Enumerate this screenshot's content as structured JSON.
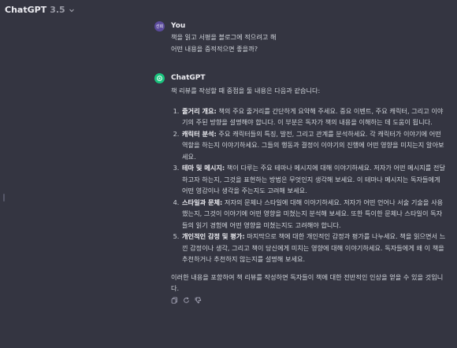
{
  "header": {
    "model_name": "ChatGPT",
    "model_version": "3.5",
    "dropdown_icon": "chevron-down-icon"
  },
  "conversation": {
    "user_message": {
      "author": "You",
      "avatar_text": "선희",
      "lines": [
        "책을 읽고 서평을 블로그에 적으려고 해",
        "어떤 내용을 중적적으면 좋을까?"
      ]
    },
    "assistant_message": {
      "author": "ChatGPT",
      "avatar_icon": "openai-logo-icon",
      "intro": "책 리뷰를 작성할 때 중점을 둘 내용은 다음과 같습니다:",
      "items": [
        {
          "title": "줄거리 개요:",
          "text": " 책의 주요 줄거리를 간단하게 요약해 주세요. 중요 이벤트, 주요 캐릭터, 그리고 이야기의 주된 방향을 설명해야 합니다. 이 부분은 독자가 책의 내용을 이해하는 데 도움이 됩니다."
        },
        {
          "title": "캐릭터 분석:",
          "text": " 주요 캐릭터들의 특징, 발전, 그리고 관계를 분석하세요. 각 캐릭터가 이야기에 어떤 역할을 하는지 이야기하세요. 그들의 행동과 결정이 이야기의 진행에 어떤 영향을 미치는지 알아보세요."
        },
        {
          "title": "테마 및 메시지:",
          "text": " 책이 다루는 주요 테마나 메시지에 대해 이야기하세요. 저자가 어떤 메시지를 전달하고자 하는지, 그것을 표현하는 방법은 무엇인지 생각해 보세요. 이 테마나 메시지는 독자들에게 어떤 영감이나 생각을 주는지도 고려해 보세요."
        },
        {
          "title": "스타일과 문체:",
          "text": " 저자의 문체나 스타일에 대해 이야기하세요. 저자가 어떤 언어나 서술 기술을 사용했는지, 그것이 이야기에 어떤 영향을 미쳤는지 분석해 보세요. 또한 특이한 문체나 스타일이 독자들의 읽기 경험에 어떤 영향을 미쳤는지도 고려해야 합니다."
        },
        {
          "title": "개인적인 감정 및 평가:",
          "text": " 마지막으로 책에 대한 개인적인 감정과 평가를 나누세요. 책을 읽으면서 느낀 감정이나 생각, 그리고 책이 당신에게 미치는 영향에 대해 이야기하세요. 독자들에게 왜 이 책을 추천하거나 추천하지 않는지를 설명해 보세요."
        }
      ],
      "closing": "이러한 내용을 포함하여 책 리뷰를 작성하면 독자들이 책에 대한 전반적인 인상을 얻을 수 있을 것입니다.",
      "actions": [
        {
          "icon": "copy-icon"
        },
        {
          "icon": "regenerate-icon"
        },
        {
          "icon": "thumbs-down-icon"
        }
      ]
    }
  },
  "colors": {
    "background": "#343541",
    "text": "#d1d5db",
    "accent_green": "#19c37d",
    "user_avatar": "#5b4b9c"
  }
}
